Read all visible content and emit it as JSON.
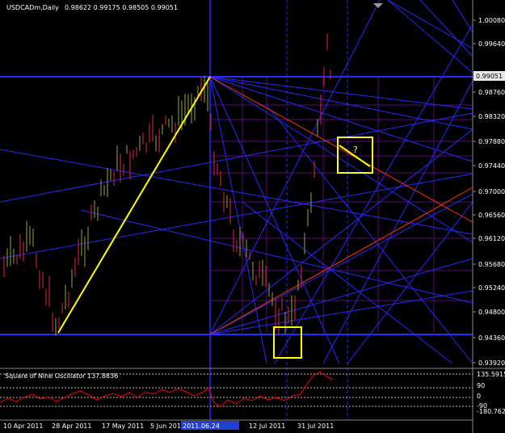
{
  "header": {
    "symbol": "USDCADm,Daily",
    "ohlc": "0.98622 0.99175 0.98505 0.99051"
  },
  "oscillator": {
    "title": "Square of Nine Oscillator 137.8836",
    "labels": [
      "135.5915",
      "90",
      "0",
      "-90",
      "-180.762"
    ]
  },
  "price_axis": {
    "labels": [
      "1.00080",
      "0.99640",
      "0.99051",
      "0.98760",
      "0.98320",
      "0.97880",
      "0.97440",
      "0.97000",
      "0.96560",
      "0.96120",
      "0.95680",
      "0.95240",
      "0.94800",
      "0.94360",
      "0.93920"
    ]
  },
  "time_axis": {
    "labels": [
      "10 Apr 2011",
      "28 Apr 2011",
      "17 May 2011",
      "5 Jun 2011",
      "2011.06.24",
      "12 Jul 2011",
      "31 Jul 2011"
    ]
  },
  "annotations": {
    "question": "?"
  },
  "colors": {
    "background": "#000000",
    "bull_candle": "#7f8b3a",
    "bear_candle": "#c0203a",
    "gann_lines": "#3030ff",
    "trend_line": "#ffff00",
    "fan_red": "#ff3300",
    "oscillator_line": "#ff0000"
  },
  "chart_data": {
    "type": "line",
    "title": "USDCADm,Daily",
    "ylim": [
      0.9392,
      1.0008
    ]
  }
}
